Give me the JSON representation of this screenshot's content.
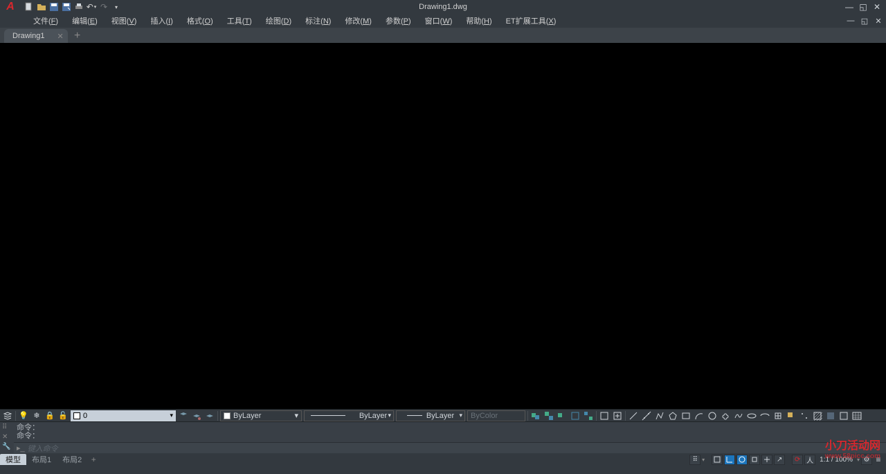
{
  "title": "Drawing1.dwg",
  "menu": [
    "文件(F)",
    "编辑(E)",
    "视图(V)",
    "插入(I)",
    "格式(O)",
    "工具(T)",
    "绘图(D)",
    "标注(N)",
    "修改(M)",
    "参数(P)",
    "窗口(W)",
    "帮助(H)",
    "ET扩展工具(X)"
  ],
  "file_tab": "Drawing1",
  "layer_value": "0",
  "color_value": "ByLayer",
  "linetype_value": "ByLayer",
  "lineweight_value": "ByLayer",
  "plotstyle_value": "ByColor",
  "cmd_hist": [
    "命令：",
    "命令："
  ],
  "cmd_placeholder": "键入命令",
  "layout_tabs": [
    "模型",
    "布局1",
    "布局2"
  ],
  "scale_text": "1:1 / 100%",
  "watermark": {
    "line1": "小刀活动网",
    "line2": "www.58picc.com"
  }
}
